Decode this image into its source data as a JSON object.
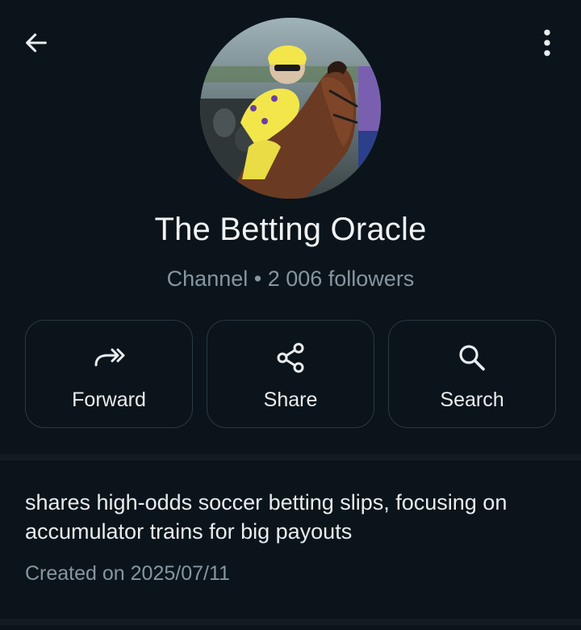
{
  "header": {
    "back_icon": "arrow-left-icon",
    "menu_icon": "more-vertical-icon"
  },
  "channel": {
    "avatar_icon": "jockey-horse-photo",
    "name": "The Betting Oracle",
    "meta": "Channel • 2 006 followers"
  },
  "actions": [
    {
      "label": "Forward",
      "icon": "forward-icon"
    },
    {
      "label": "Share",
      "icon": "share-icon"
    },
    {
      "label": "Search",
      "icon": "search-icon"
    }
  ],
  "about": {
    "description": "shares high-odds soccer betting slips, focusing on accumulator trains for big payouts",
    "created": "Created on 2025/07/11"
  },
  "colors": {
    "background": "#0b141b",
    "text_primary": "#e9edef",
    "text_secondary": "#8696a0",
    "border": "#2a3942"
  }
}
